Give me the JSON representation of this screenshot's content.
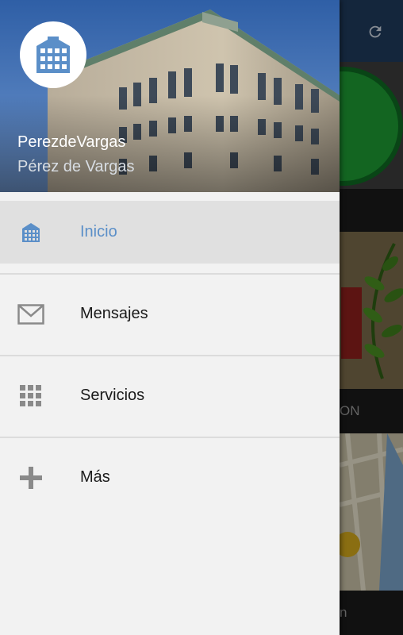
{
  "header": {
    "user_name": "PerezdeVargas",
    "user_subtitle": "Pérez de Vargas"
  },
  "menu": {
    "items": [
      {
        "label": "Inicio",
        "icon": "building-icon",
        "active": true
      },
      {
        "label": "Mensajes",
        "icon": "mail-icon",
        "active": false
      },
      {
        "label": "Servicios",
        "icon": "grid-icon",
        "active": false
      },
      {
        "label": "Más",
        "icon": "plus-icon",
        "active": false
      }
    ]
  },
  "background": {
    "strip_texts": [
      "ON",
      "n"
    ]
  },
  "colors": {
    "accent": "#5b8fc8",
    "toolbar": "#1f3b5c",
    "drawer_bg": "#f2f2f2",
    "active_row": "#e0e0e0"
  }
}
